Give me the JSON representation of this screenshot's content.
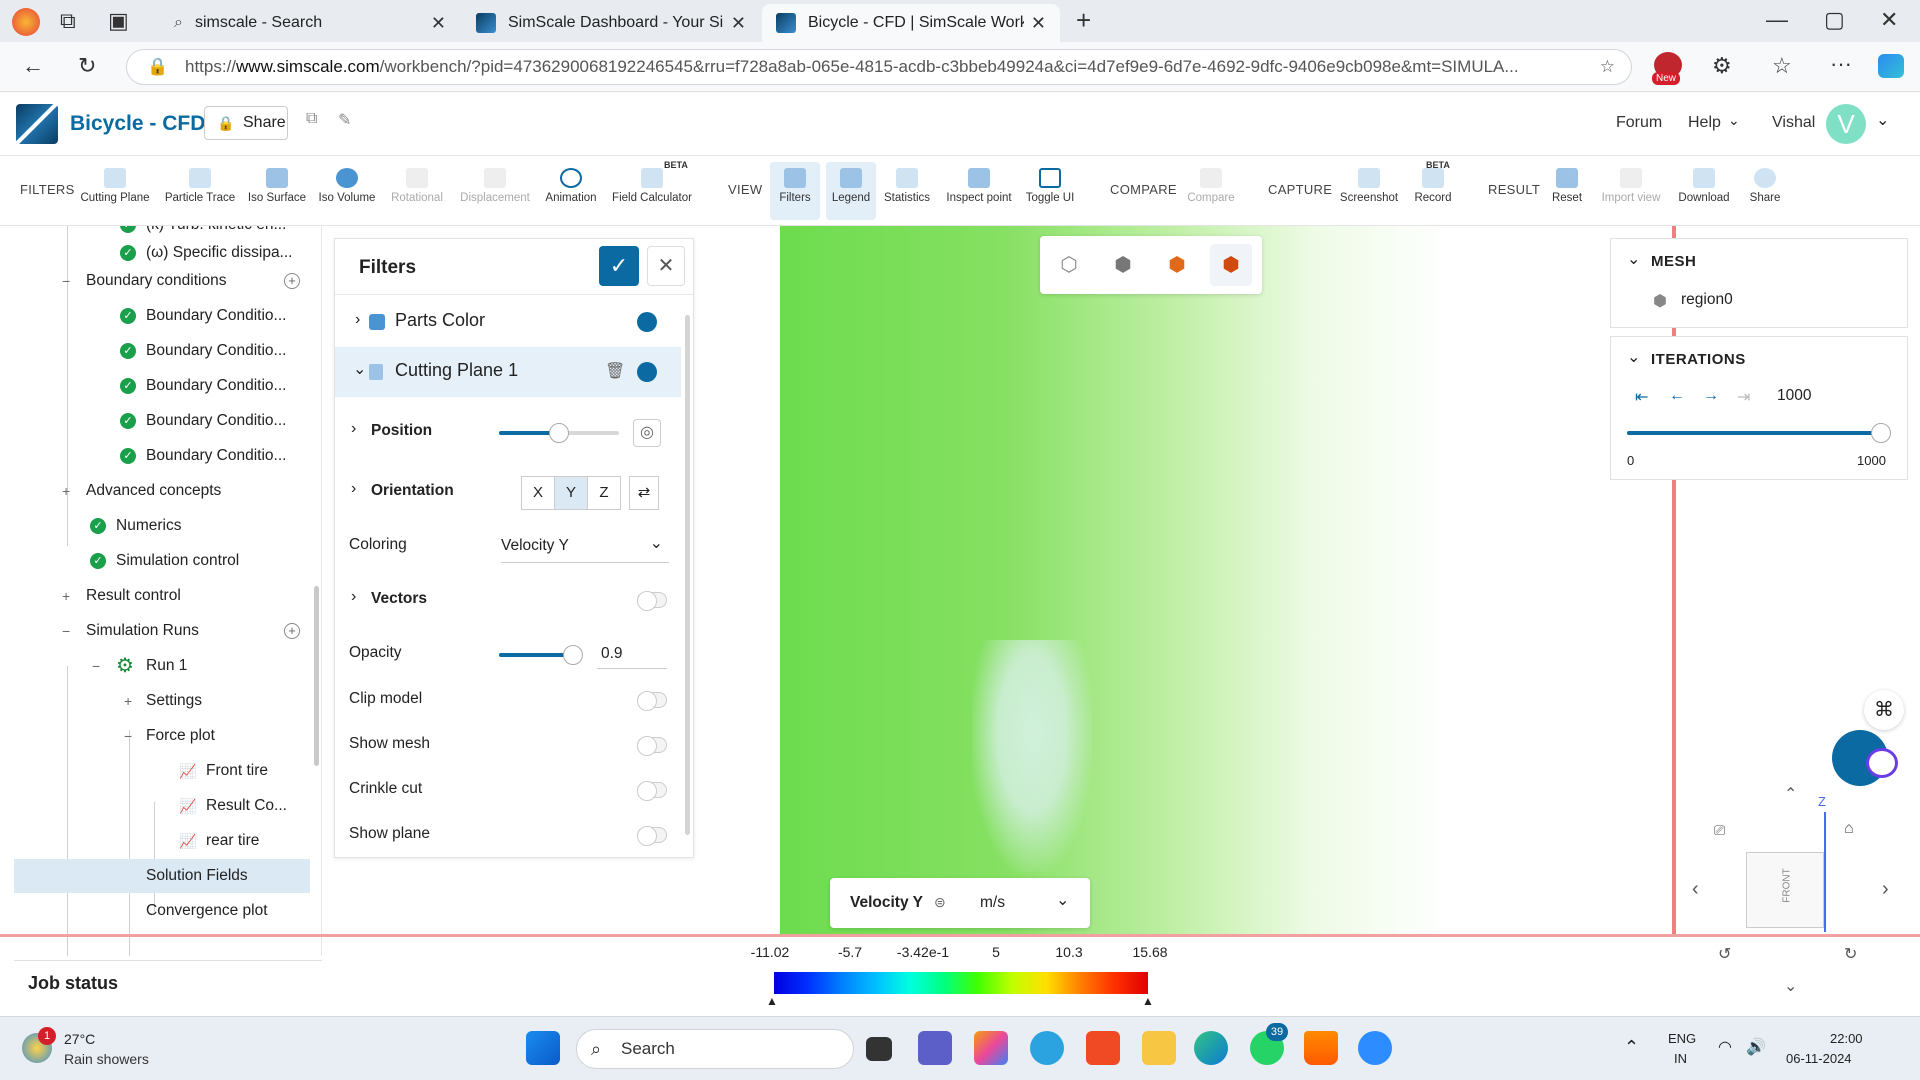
{
  "browser": {
    "tabs": [
      {
        "label": "simscale - Search"
      },
      {
        "label": "SimScale Dashboard - Your Simula"
      },
      {
        "label": "Bicycle - CFD | SimScale Workben"
      }
    ],
    "url_prefix": "https://",
    "url_host": "www.simscale.com",
    "url_rest": "/workbench/?pid=4736290068192246545&rru=f728a8ab-065e-4815-acdb-c3bbeb49924a&ci=4d7ef9e9-6d7e-4692-9dfc-9406e9cb098e&mt=SIMULA...",
    "new_badge": "New"
  },
  "app": {
    "title": "Bicycle - CFD",
    "share_label": "Share",
    "forum_label": "Forum",
    "help_label": "Help",
    "user_name": "Vishal",
    "avatar_letter": "V",
    "accent_color": "#0a6aa1"
  },
  "toolbar": {
    "filters_section": "FILTERS",
    "view_section": "VIEW",
    "compare_section": "COMPARE",
    "capture_section": "CAPTURE",
    "result_section": "RESULT",
    "beta_tag": "BETA",
    "tools": {
      "cutting_plane": "Cutting Plane",
      "particle_trace": "Particle Trace",
      "iso_surface": "Iso Surface",
      "iso_volume": "Iso Volume",
      "rotational": "Rotational",
      "displacement": "Displacement",
      "animation": "Animation",
      "field_calculator": "Field Calculator",
      "filters": "Filters",
      "legend": "Legend",
      "statistics": "Statistics",
      "inspect_point": "Inspect point",
      "toggle_ui": "Toggle UI",
      "compare": "Compare",
      "screenshot": "Screenshot",
      "record": "Record",
      "reset": "Reset",
      "import_view": "Import view",
      "download": "Download",
      "share": "Share"
    }
  },
  "tree": {
    "items": [
      {
        "label": "(k) Turb. kinetic en..."
      },
      {
        "label": "(ω) Specific dissipa..."
      },
      {
        "label": "Boundary conditions"
      },
      {
        "label": "Boundary Conditio..."
      },
      {
        "label": "Boundary Conditio..."
      },
      {
        "label": "Boundary Conditio..."
      },
      {
        "label": "Boundary Conditio..."
      },
      {
        "label": "Boundary Conditio..."
      },
      {
        "label": "Advanced concepts"
      },
      {
        "label": "Numerics"
      },
      {
        "label": "Simulation control"
      },
      {
        "label": "Result control"
      },
      {
        "label": "Simulation Runs"
      },
      {
        "label": "Run 1"
      },
      {
        "label": "Settings"
      },
      {
        "label": "Force plot"
      },
      {
        "label": "Front tire"
      },
      {
        "label": "Result Co..."
      },
      {
        "label": "rear tire"
      },
      {
        "label": "Solution Fields"
      },
      {
        "label": "Convergence plot"
      }
    ],
    "job_status": "Job status"
  },
  "filters_panel": {
    "title": "Filters",
    "parts_color": "Parts Color",
    "cutting_plane": "Cutting Plane 1",
    "position": "Position",
    "position_level": 0.5,
    "orientation": "Orientation",
    "orient_x": "X",
    "orient_y": "Y",
    "orient_z": "Z",
    "coloring_label": "Coloring",
    "coloring_value": "Velocity Y",
    "vectors": "Vectors",
    "opacity_label": "Opacity",
    "opacity_value": "0.9",
    "clip_model": "Clip model",
    "show_mesh": "Show mesh",
    "crinkle_cut": "Crinkle cut",
    "show_plane": "Show plane"
  },
  "legend": {
    "field": "Velocity Y",
    "unit": "m/s",
    "ticks": [
      "-11.02",
      "-5.7",
      "-3.42e-1",
      "5",
      "10.3",
      "15.68"
    ]
  },
  "mesh_panel": {
    "title": "MESH",
    "item": "region0"
  },
  "iterations_panel": {
    "title": "ITERATIONS",
    "value": "1000",
    "min": "0",
    "max": "1000"
  },
  "gizmo": {
    "z_label": "Z",
    "front_label": "FRONT"
  },
  "taskbar": {
    "weather_temp": "27°C",
    "weather_desc": "Rain showers",
    "weather_badge": "1",
    "search": "Search",
    "whatsapp_badge": "39",
    "lang_top": "ENG",
    "lang_bottom": "IN",
    "time": "22:00",
    "date": "06-11-2024"
  }
}
